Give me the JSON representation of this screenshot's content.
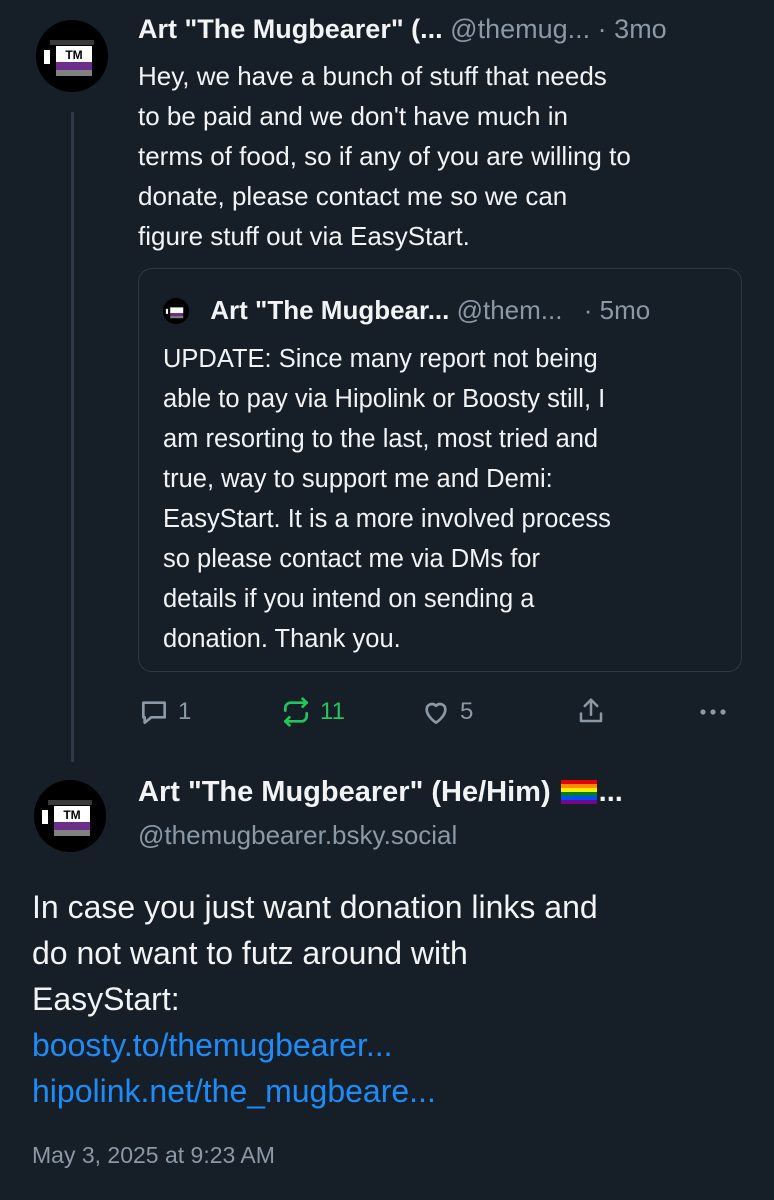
{
  "post1": {
    "author_name": "Art \"The Mugbearer\" (...",
    "handle": "@themug...",
    "separator": "·",
    "time": "3mo",
    "text_lines": [
      "Hey, we have a bunch of stuff that needs",
      "to be paid and we don't have much in",
      "terms of food, so if any of you are willing to",
      "donate, please contact me so we can",
      "figure stuff out via EasyStart."
    ],
    "quote": {
      "author_name": "Art \"The Mugbear...",
      "handle": "@them...",
      "separator": "·",
      "time": "5mo",
      "text_lines": [
        "UPDATE: Since many report not being",
        "able to pay via Hipolink or Boosty still, I",
        "am resorting to the last, most tried and",
        "true, way to support me and Demi:",
        "EasyStart. It is a more involved process",
        "so please contact me via DMs for",
        "details if you intend on sending a",
        "donation. Thank you."
      ]
    },
    "actions": {
      "reply_count": "1",
      "repost_count": "11",
      "like_count": "5"
    }
  },
  "post2": {
    "author_name": "Art \"The Mugbearer\" (He/Him)",
    "name_ellipsis": "...",
    "handle": "@themugbearer.bsky.social",
    "text_lines": [
      "In case you just want donation links and",
      "do not want to futz around with",
      "EasyStart:"
    ],
    "links": [
      "boosty.to/themugbearer...",
      "hipolink.net/the_mugbeare..."
    ],
    "timestamp": "May 3, 2025 at 9:23 AM"
  },
  "colors": {
    "background": "#161e27",
    "text": "#f1f3f5",
    "muted": "#8b98a5",
    "link": "#1d8cf8",
    "repost_active": "#22c55e"
  },
  "icons": [
    "reply-icon",
    "repost-icon",
    "like-icon",
    "share-icon",
    "more-icon",
    "rainbow-flag-icon"
  ]
}
